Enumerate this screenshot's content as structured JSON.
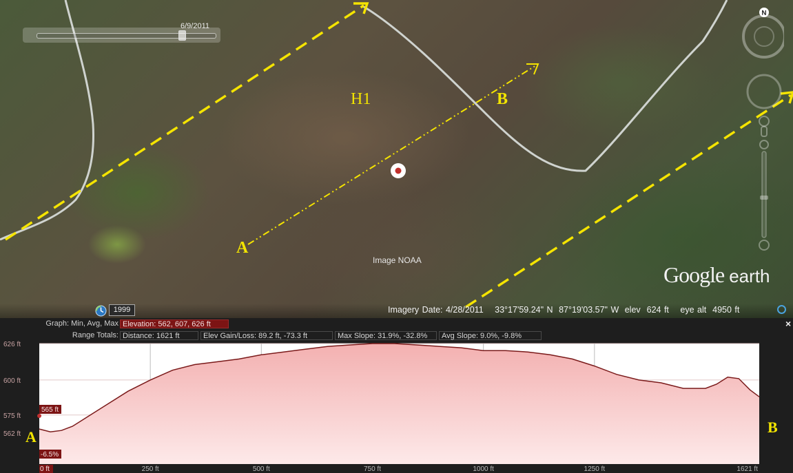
{
  "map": {
    "timeslider_date": "6/9/2011",
    "labels": {
      "h1": "H1",
      "a": "A",
      "b": "B"
    },
    "image_credit": "Image NOAA",
    "logo": {
      "google": "Google",
      "earth": "earth"
    },
    "history_year": "1999",
    "status": {
      "imagery_date": "Imagery Date: 4/28/2011",
      "lat": "33°17'59.24\" N",
      "lon": "87°19'03.57\" W",
      "elev": "elev  624 ft",
      "eye_alt": "eye alt  4950 ft"
    },
    "compass_letter": "N"
  },
  "profile": {
    "graph_label": "Graph: Min, Avg, Max",
    "elevation_box": "Elevation: 562, 607, 626 ft",
    "range_label": "Range Totals:",
    "distance_box": "Distance: 1621 ft",
    "gain_box": "Elev Gain/Loss: 89.2 ft, -73.3 ft",
    "max_slope_box": "Max Slope: 31.9%, -32.8%",
    "avg_slope_box": "Avg Slope: 9.0%, -9.8%",
    "close_label": "×",
    "cursor_elev": "565 ft",
    "cursor_slope": "-6.5%",
    "side_a": "A",
    "side_b": "B"
  },
  "chart_data": {
    "type": "area",
    "title": "",
    "xlabel": "",
    "ylabel": "",
    "x_unit": "ft",
    "y_unit": "ft",
    "xlim": [
      0,
      1621
    ],
    "ylim": [
      540,
      626
    ],
    "x_ticks": [
      0,
      250,
      500,
      750,
      1000,
      1250,
      1621
    ],
    "x_tick_labels": [
      "0 ft",
      "250 ft",
      "500 ft",
      "750 ft",
      "1000 ft",
      "1250 ft",
      "1621 ft"
    ],
    "y_ticks": [
      562,
      575,
      600,
      626
    ],
    "y_tick_labels": [
      "562 ft",
      "575 ft",
      "600 ft",
      "626 ft"
    ],
    "grid": true,
    "colors": {
      "line": "#7a1a1a",
      "fill_top": "#f4b7b7",
      "fill_bottom": "#fde8e8"
    },
    "series": [
      {
        "x": [
          0,
          25,
          50,
          75,
          100,
          150,
          200,
          250,
          300,
          350,
          400,
          450,
          500,
          550,
          600,
          650,
          700,
          750,
          800,
          850,
          900,
          950,
          1000,
          1050,
          1100,
          1150,
          1200,
          1250,
          1300,
          1350,
          1400,
          1450,
          1500,
          1525,
          1550,
          1575,
          1600,
          1621
        ],
        "y": [
          565,
          563,
          564,
          567,
          572,
          582,
          592,
          600,
          607,
          611,
          613,
          615,
          618,
          620,
          622,
          624,
          625,
          626,
          626,
          625,
          624,
          623,
          621,
          621,
          620,
          618,
          615,
          610,
          604,
          600,
          598,
          594,
          594,
          597,
          602,
          601,
          593,
          588
        ]
      }
    ]
  }
}
